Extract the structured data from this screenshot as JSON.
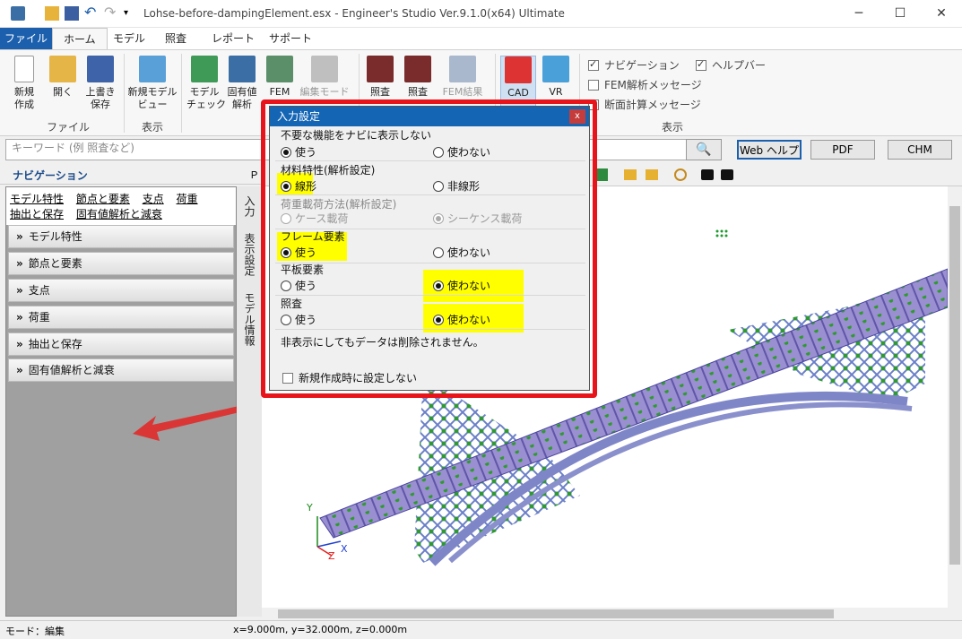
{
  "window": {
    "title": "Lohse-before-dampingElement.esx - Engineer's Studio Ver.9.1.0(x64) Ultimate",
    "minimize": "─",
    "maximize": "☐",
    "close": "✕"
  },
  "menu": {
    "tabs": [
      "ファイル",
      "ホーム",
      "モデル",
      "照査",
      "レポート",
      "サポート"
    ]
  },
  "ribbon": {
    "file_group": {
      "label": "ファイル",
      "new": "新規\n作成",
      "open": "開く",
      "save": "上書き\n保存"
    },
    "view_group": {
      "label": "表示",
      "new_model_view": "新規モデル\nビュー"
    },
    "analysis": {
      "model_check": "モデル\nチェック",
      "eigen": "固有値\n解析",
      "fem": "FEM",
      "edit_mode": "編集モード"
    },
    "check": {
      "check1": "照査",
      "check2": "照査",
      "fem_result": "FEM結果"
    },
    "tools": {
      "cad": "CAD",
      "vr": "VR"
    },
    "display_group": {
      "label": "表示",
      "navigation": "ナビゲーション",
      "help_bar": "ヘルプバー",
      "fem_msg": "FEM解析メッセージ",
      "section_msg": "断面計算メッセージ"
    }
  },
  "search": {
    "placeholder": "キーワード (例 照査など)",
    "web_help": "Web ヘルプ",
    "pdf": "PDF",
    "chm": "CHM"
  },
  "navigation": {
    "title": "ナビゲーション",
    "links_row1": [
      "モデル特性",
      "節点と要素",
      "支点",
      "荷重"
    ],
    "links_row2": [
      "抽出と保存",
      "固有値解析と減衰"
    ],
    "sections": [
      "モデル特性",
      "節点と要素",
      "支点",
      "荷重",
      "抽出と保存",
      "固有値解析と減衰"
    ],
    "vertical_tabs": [
      "入力",
      "表示設定",
      "モデル情報"
    ]
  },
  "dialog": {
    "title": "入力設定",
    "close": "x",
    "sections": [
      {
        "title": "不要な機能をナビに表示しない",
        "left": "使う",
        "right": "使わない",
        "selected": "left",
        "disabled": false
      },
      {
        "title": "材料特性(解析設定)",
        "left": "線形",
        "right": "非線形",
        "selected": "left",
        "disabled": false
      },
      {
        "title": "荷重載荷方法(解析設定)",
        "left": "ケース載荷",
        "right": "シーケンス載荷",
        "selected": "right",
        "disabled": true
      },
      {
        "title": "フレーム要素",
        "left": "使う",
        "right": "使わない",
        "selected": "left",
        "disabled": false
      },
      {
        "title": "平板要素",
        "left": "使う",
        "right": "使わない",
        "selected": "right",
        "disabled": false
      },
      {
        "title": "照査",
        "left": "使う",
        "right": "使わない",
        "selected": "right",
        "disabled": false
      }
    ],
    "note": "非表示にしてもデータは削除されません。",
    "no_setting_on_new": "新規作成時に設定しない"
  },
  "axes": {
    "y": "Y",
    "z": "Z",
    "x": "X"
  },
  "status": {
    "mode": "モード：編集",
    "coords": "x=9.000m, y=32.000m, z=0.000m"
  },
  "colors": {
    "highlight": "#ffff00",
    "frame": "#e8141b",
    "accent": "#1b5fad"
  }
}
